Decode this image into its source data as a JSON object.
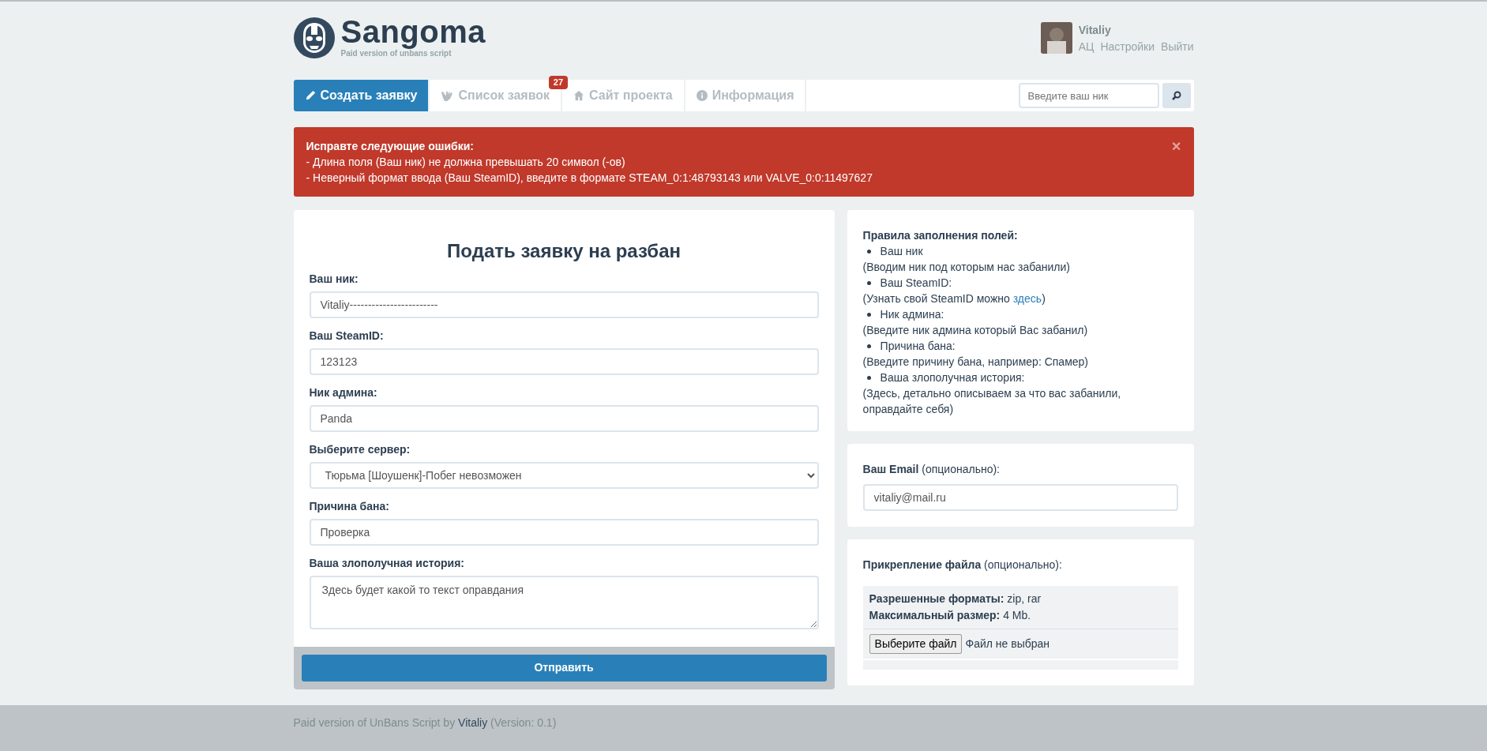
{
  "header": {
    "logo": {
      "title": "Sangoma",
      "subtitle": "Paid version of unbans script"
    },
    "user": {
      "name": "Vitaliy",
      "links": [
        "АЦ",
        "Настройки",
        "Выйти"
      ]
    }
  },
  "nav": {
    "tabs": [
      {
        "label": "Создать заявку",
        "selected": true
      },
      {
        "label": "Список заявок",
        "selected": false,
        "badge": "27"
      },
      {
        "label": "Сайт проекта",
        "selected": false
      },
      {
        "label": "Информация",
        "selected": false
      }
    ],
    "search": {
      "placeholder": "Введите ваш ник"
    }
  },
  "alert": {
    "title": "Исправте следующие ошибки:",
    "lines": [
      "- Длина поля (Ваш ник) не должна превышать 20 символ (-ов)",
      "- Неверный формат ввода (Ваш SteamID), введите в формате STEAM_0:1:48793143 или VALVE_0:0:11497627"
    ],
    "close": "×"
  },
  "form": {
    "title": "Подать заявку на разбан",
    "fields": [
      {
        "label": "Ваш ник:",
        "kind": "text",
        "value": "Vitaliy------------------------"
      },
      {
        "label": "Ваш SteamID:",
        "kind": "text",
        "value": "123123"
      },
      {
        "label": "Ник админа:",
        "kind": "text",
        "value": "Panda"
      },
      {
        "label": "Выберите сервер:",
        "kind": "select",
        "value": "Тюрьма [Шоушенк]-Побег невозможен"
      },
      {
        "label": "Причина бана:",
        "kind": "text",
        "value": "Проверка"
      },
      {
        "label": "Ваша злополучная история:",
        "kind": "textarea",
        "value": "Здесь будет какой то текст оправдания"
      }
    ],
    "submit": "Отправить"
  },
  "rules": {
    "title": "Правила заполнения полей:",
    "items": [
      {
        "name": "Ваш ник",
        "hint": "(Вводим ник под которым нас забанили)"
      },
      {
        "name": "Ваш SteamID:",
        "hint": "(Узнать свой SteamID можно ",
        "link": "здесь",
        "hint_end": ")"
      },
      {
        "name": "Ник админа:",
        "hint": "(Введите ник админа который Вас забанил)"
      },
      {
        "name": "Причина бана:",
        "hint": "(Введите причину бана, например: Спамер)"
      },
      {
        "name": "Ваша злополучная история:",
        "hint": "(Здесь, детально описываем за что вас забанили, оправдайте себя)"
      }
    ]
  },
  "email": {
    "label": "Ваш Email",
    "note": "(опционально):",
    "value": "vitaliy@mail.ru"
  },
  "attachment": {
    "label": "Прикрепление файла",
    "note": "(опционально):",
    "formats_label": "Разрешенные форматы:",
    "formats": "zip, rar",
    "size_label": "Максимальный размер:",
    "size": "4 Mb.",
    "button": "Выберите файл",
    "status": "Файл не выбран"
  },
  "footer": {
    "text": "Paid version of UnBans Script by",
    "author": "Vitaliy",
    "version": "(Version: 0.1)"
  }
}
